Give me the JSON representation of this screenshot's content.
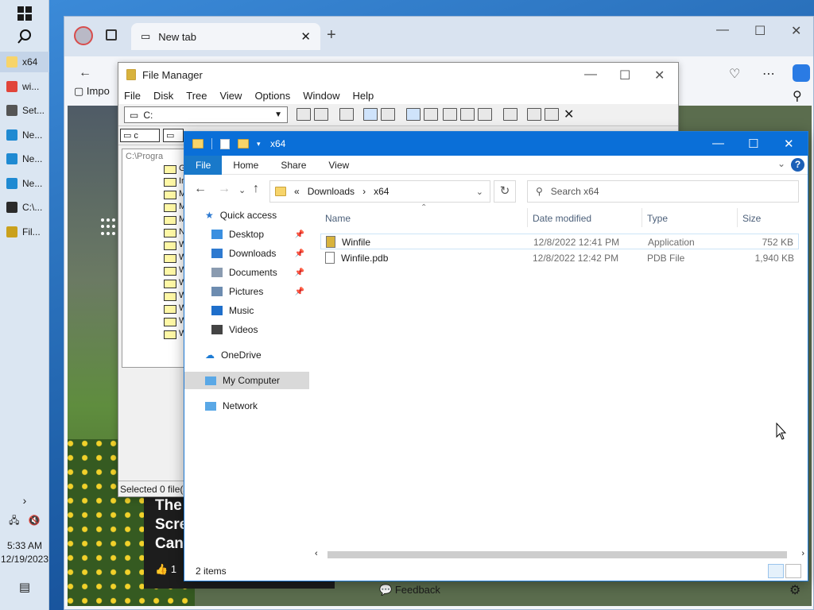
{
  "taskbar": {
    "items": [
      {
        "label": "x64",
        "color": "#f7d46a"
      },
      {
        "label": "wi...",
        "color": "#e1453a"
      },
      {
        "label": "Set...",
        "color": "#555555"
      },
      {
        "label": "Ne...",
        "color": "#1f8ad2"
      },
      {
        "label": "Ne...",
        "color": "#1f8ad2"
      },
      {
        "label": "Ne...",
        "color": "#1f8ad2"
      },
      {
        "label": "C:\\...",
        "color": "#2b2b2b"
      },
      {
        "label": "Fil...",
        "color": "#caa11d"
      }
    ],
    "time": "5:33 AM",
    "date": "12/19/2023"
  },
  "browser": {
    "tab_label": "New tab",
    "toolbar_partial": "Impo",
    "feedback_label": "Feedback",
    "news_title_lines": [
      "The",
      "Scre",
      "Can"
    ],
    "like_count": "1"
  },
  "filemanager": {
    "title": "File Manager",
    "menu": [
      "File",
      "Disk",
      "Tree",
      "View",
      "Options",
      "Window",
      "Help"
    ],
    "drive_selected": "C:",
    "drive_label": "c",
    "tree_path": "C:\\Progra",
    "tree_letters": [
      "G",
      "In",
      "M",
      "M",
      "M",
      "N",
      "W",
      "W",
      "W",
      "W",
      "W",
      "W",
      "W",
      "W"
    ],
    "status": "Selected 0 file(s"
  },
  "explorer": {
    "title": "x64",
    "ribbon_tabs": [
      "File",
      "Home",
      "Share",
      "View"
    ],
    "breadcrumb": [
      "Downloads",
      "x64"
    ],
    "breadcrumb_prefix": "«",
    "search_placeholder": "Search x64",
    "nav": {
      "quick_access": "Quick access",
      "pinned": [
        "Desktop",
        "Downloads",
        "Documents",
        "Pictures"
      ],
      "unpinned": [
        "Music",
        "Videos"
      ],
      "onedrive": "OneDrive",
      "mycomputer": "My Computer",
      "network": "Network"
    },
    "columns": {
      "name": "Name",
      "date": "Date modified",
      "type": "Type",
      "size": "Size"
    },
    "files": [
      {
        "name": "Winfile",
        "date": "12/8/2022 12:41 PM",
        "type": "Application",
        "size": "752 KB",
        "icon": "app-icon"
      },
      {
        "name": "Winfile.pdb",
        "date": "12/8/2022 12:42 PM",
        "type": "PDB File",
        "size": "1,940 KB",
        "icon": "file-icon"
      }
    ],
    "status": "2 items"
  },
  "colors": {
    "accent": "#0a6fd8",
    "folder": "#f7d46a"
  }
}
